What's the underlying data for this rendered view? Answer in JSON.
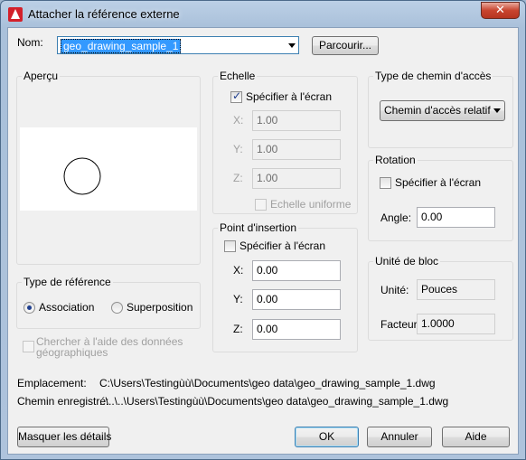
{
  "window": {
    "title": "Attacher la référence externe",
    "close_symbol": "✕"
  },
  "name": {
    "label": "Nom:",
    "value": "geo_drawing_sample_1",
    "browse_label": "Parcourir..."
  },
  "preview": {
    "title": "Aperçu"
  },
  "scale": {
    "title": "Echelle",
    "specify_on_screen_label": "Spécifier à l'écran",
    "specify_on_screen_checked": true,
    "x_label": "X:",
    "x_value": "1.00",
    "y_label": "Y:",
    "y_value": "1.00",
    "z_label": "Z:",
    "z_value": "1.00",
    "uniform_label": "Echelle uniforme"
  },
  "path_type": {
    "title": "Type de chemin d'accès",
    "selected": "Chemin d'accès relatif"
  },
  "rotation": {
    "title": "Rotation",
    "specify_on_screen_label": "Spécifier à l'écran",
    "angle_label": "Angle:",
    "angle_value": "0.00"
  },
  "insertion_point": {
    "title": "Point d'insertion",
    "specify_on_screen_label": "Spécifier à l'écran",
    "x_label": "X:",
    "x_value": "0.00",
    "y_label": "Y:",
    "y_value": "0.00",
    "z_label": "Z:",
    "z_value": "0.00"
  },
  "reference_type": {
    "title": "Type de référence",
    "option_attach": "Association",
    "option_overlay": "Superposition",
    "selected": "Association"
  },
  "geo_locate": {
    "label_line1": "Chercher à l'aide des données",
    "label_line2": "géographiques"
  },
  "block_unit": {
    "title": "Unité de bloc",
    "unit_label": "Unité:",
    "unit_value": "Pouces",
    "factor_label": "Facteur:",
    "factor_value": "1.0000"
  },
  "info": {
    "location_label": "Emplacement:",
    "location_value": "C:\\Users\\Testingùù\\Documents\\geo data\\geo_drawing_sample_1.dwg",
    "saved_path_label": "Chemin enregistré:",
    "saved_path_value": "..\\..\\..\\Users\\Testingùù\\Documents\\geo data\\geo_drawing_sample_1.dwg"
  },
  "footer": {
    "hide_details_label": "Masquer les détails",
    "ok_label": "OK",
    "cancel_label": "Annuler",
    "help_label": "Aide"
  },
  "colors": {
    "title_bar": "#b0c6df",
    "close_button": "#c8452f",
    "dialog_background": "#f0f0f0",
    "default_button_border": "#3c7fb1"
  }
}
